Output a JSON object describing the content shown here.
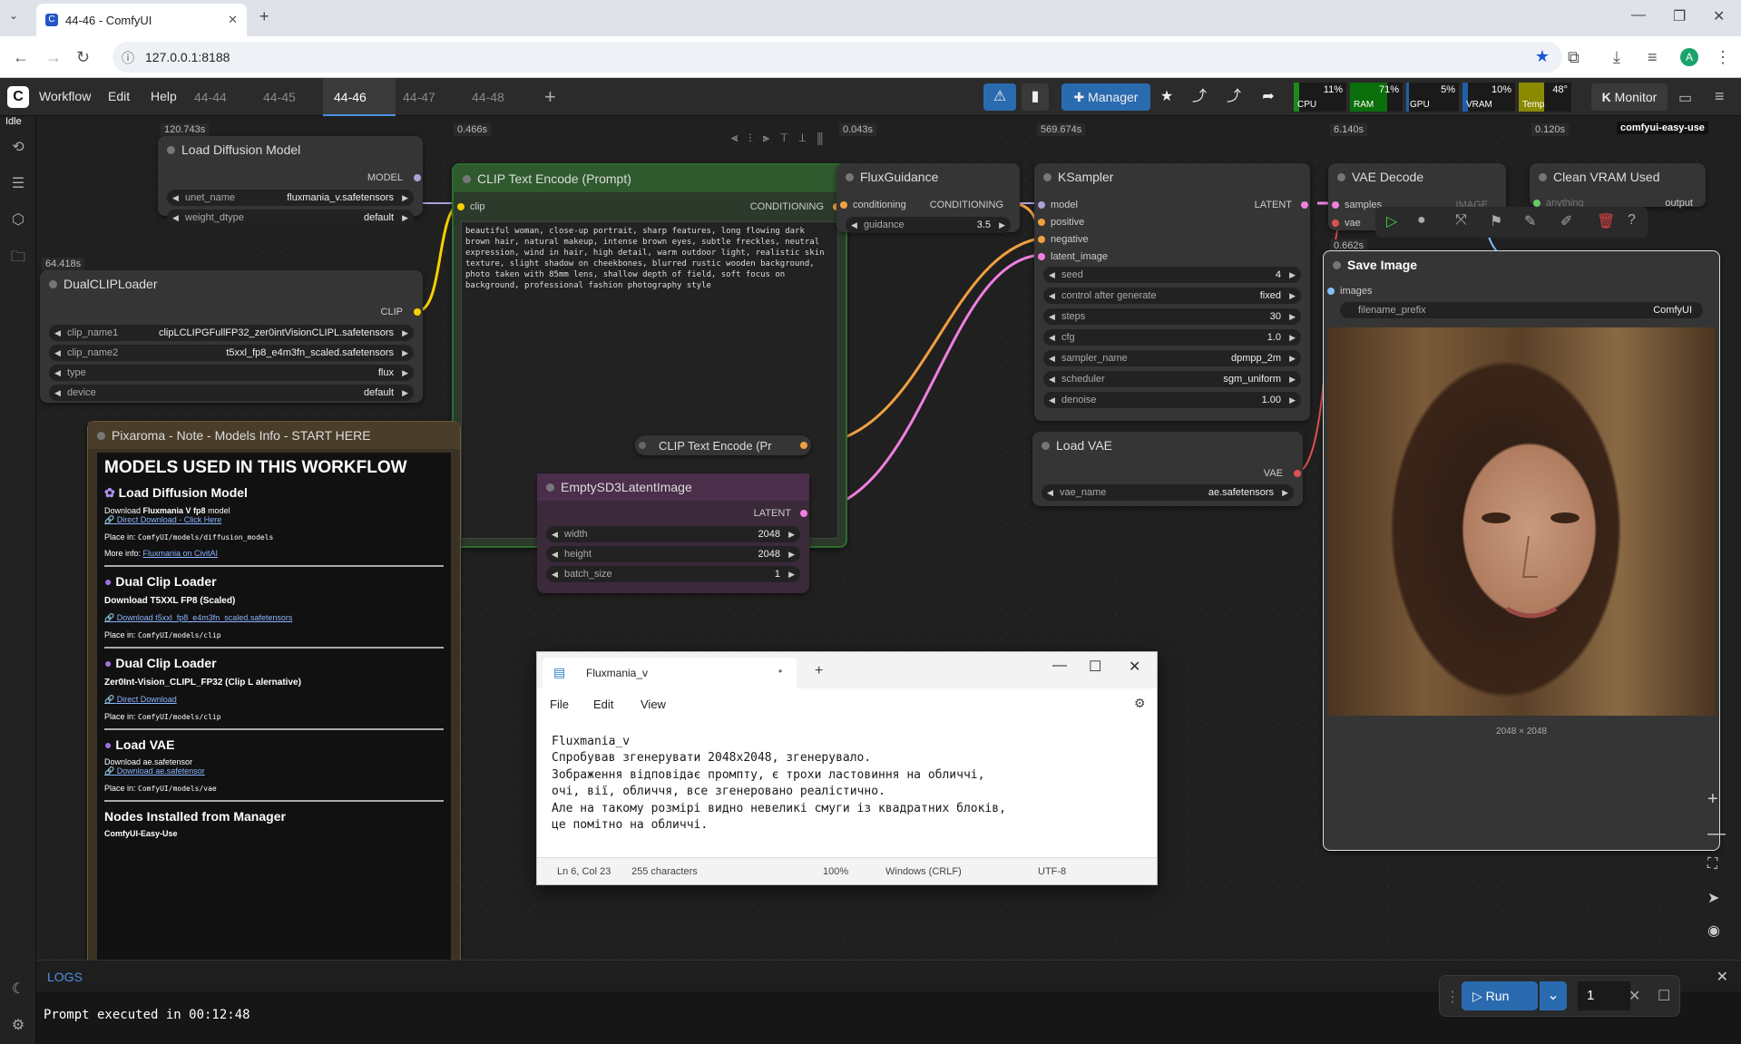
{
  "browser": {
    "tab_title": "44-46 - ComfyUI",
    "url": "127.0.0.1:8188",
    "profile_initial": "A"
  },
  "app": {
    "menu": [
      "Workflow",
      "Edit",
      "Help"
    ],
    "status": "Idle",
    "workflow_tabs": [
      "44-44",
      "44-45",
      "44-46",
      "44-47",
      "44-48"
    ],
    "active_tab": "44-46",
    "manager_label": "Manager",
    "monitor_label": "Monitor",
    "monitors": [
      {
        "label": "CPU",
        "value": "11%",
        "fraction": 0.11,
        "color": "#1a8a1a"
      },
      {
        "label": "RAM",
        "value": "71%",
        "fraction": 0.71,
        "color": "#0a6e0a"
      },
      {
        "label": "GPU",
        "value": "5%",
        "fraction": 0.05,
        "color": "#1e5fa8"
      },
      {
        "label": "VRAM",
        "value": "10%",
        "fraction": 0.1,
        "color": "#1e5fa8"
      },
      {
        "label": "Temp",
        "value": "48°",
        "fraction": 0.48,
        "color": "#8a8a00"
      }
    ]
  },
  "nodes": {
    "load_diffusion": {
      "timing": "120.743s",
      "title": "Load Diffusion Model",
      "out": "MODEL",
      "unet_name_label": "unet_name",
      "unet_name": "fluxmania_v.safetensors",
      "weight_dtype_label": "weight_dtype",
      "weight_dtype": "default"
    },
    "dualclip": {
      "timing": "64.418s",
      "title": "DualCLIPLoader",
      "out": "CLIP",
      "clip_name1_label": "clip_name1",
      "clip_name1": "clipLCLIPGFullFP32_zer0intVisionCLIPL.safetensors",
      "clip_name2_label": "clip_name2",
      "clip_name2": "t5xxl_fp8_e4m3fn_scaled.safetensors",
      "type_label": "type",
      "type": "flux",
      "device_label": "device",
      "device": "default"
    },
    "clip_text": {
      "timing": "0.466s",
      "title": "CLIP Text Encode (Prompt)",
      "in": "clip",
      "out": "CONDITIONING",
      "prompt": "beautiful woman, close-up portrait, sharp features, long flowing dark brown hair, natural makeup, intense brown eyes, subtle freckles, neutral expression, wind in hair, high detail, warm outdoor light, realistic skin texture, slight shadow on cheekbones, blurred rustic wooden background, photo taken with 85mm lens, shallow depth of field, soft focus on background, professional fashion photography style"
    },
    "flux_guidance": {
      "timing": "0.043s",
      "title": "FluxGuidance",
      "in": "conditioning",
      "out": "CONDITIONING",
      "guidance_label": "guidance",
      "guidance": "3.5"
    },
    "ksampler": {
      "timing": "569.674s",
      "title": "KSampler",
      "in_model": "model",
      "in_positive": "positive",
      "in_negative": "negative",
      "in_latent": "latent_image",
      "out": "LATENT",
      "widgets": [
        [
          "seed",
          "4"
        ],
        [
          "control after generate",
          "fixed"
        ],
        [
          "steps",
          "30"
        ],
        [
          "cfg",
          "1.0"
        ],
        [
          "sampler_name",
          "dpmpp_2m"
        ],
        [
          "scheduler",
          "sgm_uniform"
        ],
        [
          "denoise",
          "1.00"
        ]
      ]
    },
    "vae_decode": {
      "timing": "6.140s",
      "title": "VAE Decode",
      "in_samples": "samples",
      "in_vae": "vae",
      "out": "IMAGE"
    },
    "clean_vram": {
      "timing": "0.120s",
      "title": "Clean VRAM Used",
      "badge": "comfyui-easy-use",
      "in": "anything",
      "out": "output"
    },
    "save_image": {
      "timing": "0.662s",
      "title": "Save Image",
      "in": "images",
      "prefix_label": "filename_prefix",
      "prefix": "ComfyUI",
      "size": "2048 × 2048"
    },
    "clip_text_collapsed": {
      "title": "CLIP Text Encode (Pr"
    },
    "empty_latent": {
      "title": "EmptySD3LatentImage",
      "out": "LATENT",
      "width_label": "width",
      "width": "2048",
      "height_label": "height",
      "height": "2048",
      "batch_label": "batch_size",
      "batch": "1"
    },
    "load_vae": {
      "title": "Load VAE",
      "out": "VAE",
      "vae_name_label": "vae_name",
      "vae_name": "ae.safetensors"
    }
  },
  "note": {
    "title": "Pixaroma - Note - Models Info - START HERE",
    "heading": "MODELS USED IN THIS WORKFLOW",
    "s1_title": "Load Diffusion Model",
    "s1_dl_pre": "Download ",
    "s1_dl_bold": "Fluxmania V fp8",
    "s1_dl_post": " model",
    "s1_link": "Direct Download - Click Here",
    "s1_place_label": "Place in: ",
    "s1_place": "ComfyUI/models/diffusion_models",
    "s1_more_label": "More info: ",
    "s1_more": "Fluxmania on CivitAI",
    "s2_title": "Dual Clip Loader",
    "s2_text": "Download T5XXL FP8 (Scaled)",
    "s2_link": "Download t5xxl_fp8_e4m3fn_scaled.safetensors",
    "s2_place_label": "Place in: ",
    "s2_place": "ComfyUI/models/clip",
    "s3_title": "Dual Clip Loader",
    "s3_text": "Zer0Int-Vision_CLIPL_FP32 (Clip L alernative)",
    "s3_link": "Direct Download",
    "s3_place_label": "Place in: ",
    "s3_place": "ComfyUI/models/clip",
    "s4_title": "Load VAE",
    "s4_text": "Download ae.safetensor",
    "s4_link": "Download ae.safetensor",
    "s4_place_label": "Place in: ",
    "s4_place": "ComfyUI/models/vae",
    "s5_title": "Nodes Installed from Manager",
    "s5_text": "ComfyUI-Easy-Use"
  },
  "notepad": {
    "tab_title": "Fluxmania_v",
    "menu": [
      "File",
      "Edit",
      "View"
    ],
    "lines": [
      "Fluxmania_v",
      "Спробував згенерувати 2048x2048, згенерувало.",
      "Зображення відповідає промпту, є трохи ластовиння на обличчі,",
      "очі, вії, обличчя, все згенеровано реалістично.",
      "Але на такому розмірі видно невеликі смуги із квадратних блоків,",
      "це помітно на обличчі."
    ],
    "status_pos": "Ln 6, Col 23",
    "status_chars": "255 characters",
    "status_zoom": "100%",
    "status_eol": "Windows (CRLF)",
    "status_enc": "UTF-8"
  },
  "logs": {
    "title": "LOGS",
    "text": "Prompt executed in 00:12:48"
  },
  "run": {
    "label": "Run",
    "count": "1"
  }
}
